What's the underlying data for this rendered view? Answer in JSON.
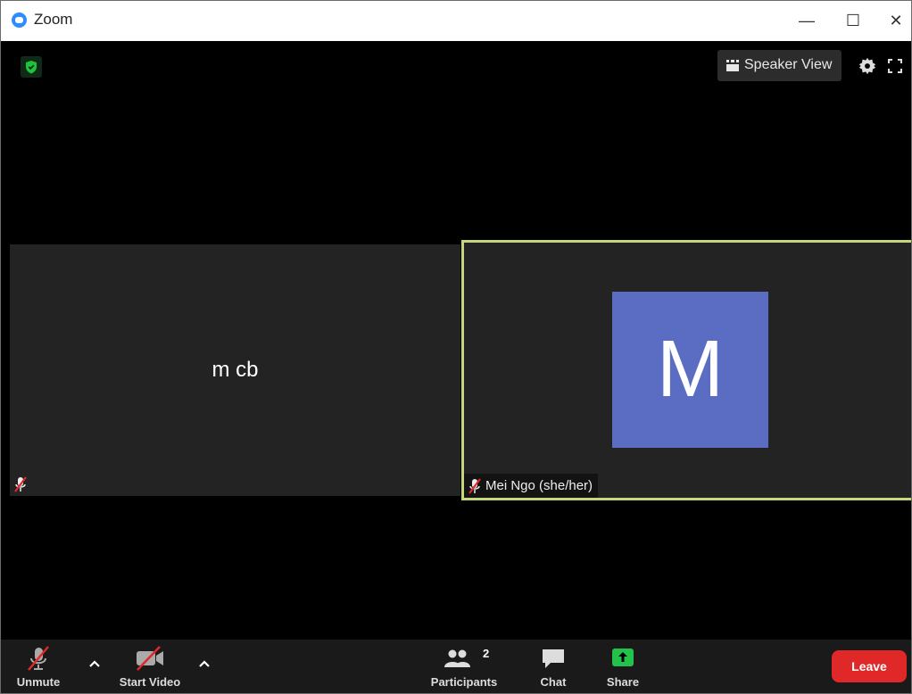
{
  "window": {
    "title": "Zoom",
    "min_glyph": "—",
    "max_glyph": "☐",
    "close_glyph": "✕",
    "brand_color": "#2d8cff"
  },
  "topbar": {
    "security_icon": "shield-check-icon",
    "security_color": "#1ec33c",
    "view_label": "Speaker View",
    "settings_icon": "gear-icon",
    "fullscreen_icon": "fullscreen-icon"
  },
  "tiles": [
    {
      "name": "m cb",
      "muted": true,
      "video": false,
      "active_speaker": false
    },
    {
      "name": "Mei Ngo (she/her)",
      "avatar_letter": "M",
      "avatar_color": "#5b6dc2",
      "muted": true,
      "video": false,
      "active_speaker": true,
      "highlight_color": "#c6d77a"
    }
  ],
  "toolbar": {
    "unmute_label": "Unmute",
    "start_video_label": "Start Video",
    "participants_label": "Participants",
    "participants_count": "2",
    "chat_label": "Chat",
    "share_label": "Share",
    "share_color": "#22c24b",
    "leave_label": "Leave",
    "leave_color": "#e02828"
  }
}
